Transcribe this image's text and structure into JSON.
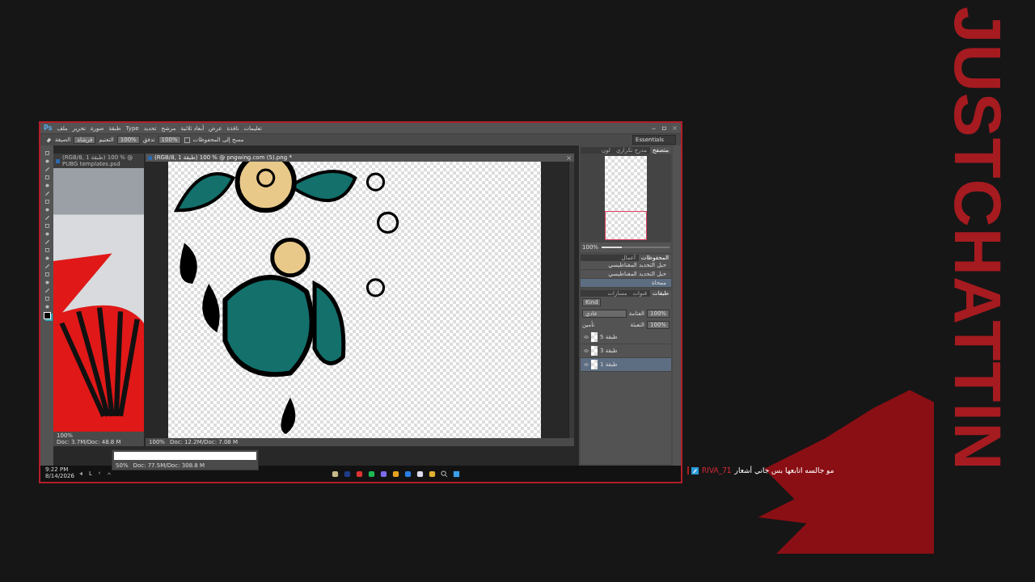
{
  "brand": "JUSTCHATTIN",
  "app": {
    "logo": "Ps",
    "menu": [
      "تعليمات",
      "نافذة",
      "عرض",
      "أبعاد ثلاثية",
      "مرشح",
      "تحديد",
      "Type",
      "طبقة",
      "صورة",
      "تحرير",
      "ملف"
    ],
    "options": {
      "mode_label": "الصيغة",
      "mode": "فرشاة",
      "opacity_label": "التعتيم",
      "opacity": "100%",
      "flow_label": "تدفق",
      "flow": "100%",
      "erase_history_checked": false,
      "erase_label": "مسح إلى المحفوظات"
    },
    "workspace": "Essentials"
  },
  "documents": [
    {
      "title": "(RGB/8, 1 طبقة) 100 % @ pngwing.com (5).png *",
      "zoom": "100%",
      "status": "Doc: 12.2M/Doc: 7.08 M",
      "active": true
    },
    {
      "title": "(RGB/8, 1 طبقة) 100 % @ PUBG templates.psd",
      "zoom": "100%",
      "status": "Doc: 3.7M/Doc: 48.8 M",
      "active": false
    }
  ],
  "floating_doc": {
    "zoom": "50%",
    "status": "Doc: 77.5M/Doc: 308.8 M"
  },
  "navigator": {
    "tabs": [
      {
        "label": "متصفح",
        "selected": true
      },
      {
        "label": "مدرج تكراري",
        "selected": false
      },
      {
        "label": "لون",
        "selected": false
      }
    ],
    "zoom": "100%",
    "level": 0.3
  },
  "history": {
    "tabs": [
      {
        "label": "المحفوظات",
        "selected": true
      },
      {
        "label": "أعمال",
        "selected": false
      }
    ],
    "items": [
      {
        "label": "حبل التحديد المغناطيسي",
        "selected": false
      },
      {
        "label": "حبل التحديد المغناطيسي",
        "selected": false
      },
      {
        "label": "ممحاة",
        "selected": true
      }
    ]
  },
  "layers": {
    "tabs": [
      {
        "label": "طبقات",
        "selected": true
      },
      {
        "label": "قنوات",
        "selected": false
      },
      {
        "label": "مسارات",
        "selected": false
      }
    ],
    "filter": "Kind",
    "blend_mode": "عادي",
    "opacity_label": "العتامة",
    "opacity": "100%",
    "lock_label": "تأمين",
    "fill_label": "التعبئة",
    "fill": "100%",
    "items": [
      {
        "name": "طبقة 5",
        "visible": true,
        "selected": false
      },
      {
        "name": "طبقة 3",
        "visible": true,
        "selected": false
      },
      {
        "name": "طبقة 1",
        "visible": true,
        "selected": true
      }
    ]
  },
  "taskbar": {
    "time": "9:22 PM",
    "date": "8/14/2026",
    "language": "L"
  },
  "chat": {
    "user": "RIVA_71",
    "message": "مو جالسه اتابعها بس جاني أشعار"
  }
}
